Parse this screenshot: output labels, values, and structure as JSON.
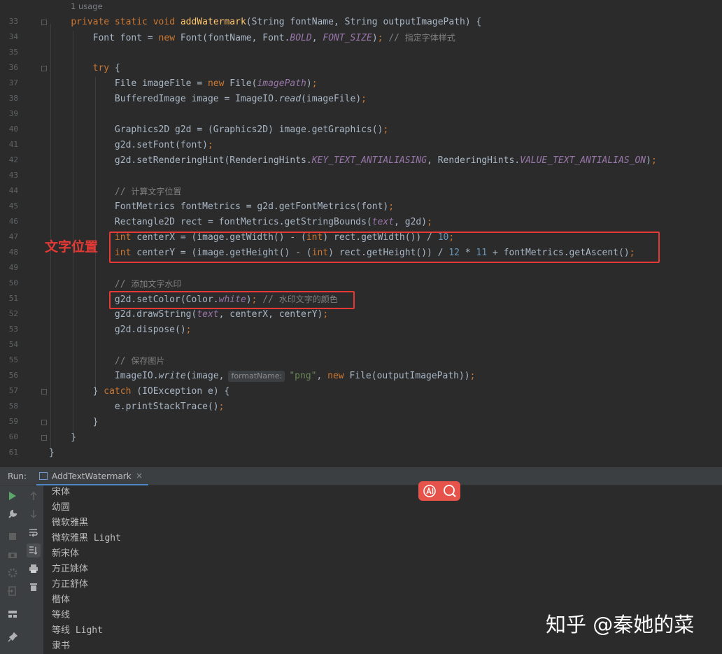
{
  "editor": {
    "usage_hint": "1 usage",
    "line_numbers": [
      "33",
      "34",
      "35",
      "36",
      "37",
      "38",
      "39",
      "40",
      "41",
      "42",
      "43",
      "44",
      "45",
      "46",
      "47",
      "48",
      "49",
      "50",
      "51",
      "52",
      "53",
      "54",
      "55",
      "56",
      "57",
      "58",
      "59",
      "60",
      "61"
    ],
    "param_hint": "formatName:"
  },
  "annotation": {
    "label": "文字位置"
  },
  "run": {
    "label": "Run:",
    "tab_label": "AddTextWatermark",
    "close_glyph": "×",
    "output": [
      "宋体",
      "幼圆",
      "微软雅黑",
      "微软雅黑 Light",
      "新宋体",
      "方正姚体",
      "方正舒体",
      "楷体",
      "等线",
      "等线 Light",
      "隶书"
    ]
  },
  "watermark": {
    "text": "知乎 @秦她的菜"
  },
  "colors": {
    "highlight": "#e53935",
    "keyword": "#cc7832",
    "function": "#ffc66d",
    "static": "#9876aa",
    "number": "#6897bb",
    "string": "#6a8759",
    "comment": "#808080"
  }
}
